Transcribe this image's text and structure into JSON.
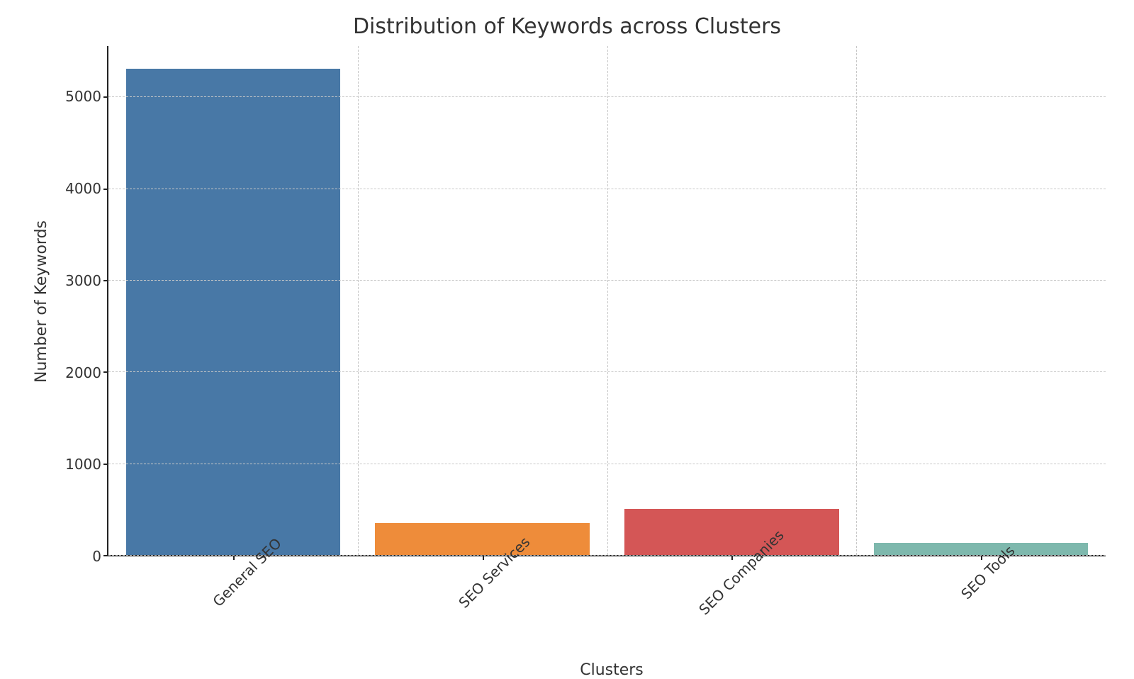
{
  "chart_data": {
    "type": "bar",
    "title": "Distribution of Keywords across Clusters",
    "xlabel": "Clusters",
    "ylabel": "Number of Keywords",
    "categories": [
      "General SEO",
      "SEO Services",
      "SEO Companies",
      "SEO Tools"
    ],
    "values": [
      5300,
      350,
      500,
      130
    ],
    "colors": [
      "#4878a6",
      "#ee8c3a",
      "#d45656",
      "#7eb8ad"
    ],
    "yticks": [
      0,
      1000,
      2000,
      3000,
      4000,
      5000
    ],
    "ylim": [
      0,
      5550
    ],
    "grid": true
  }
}
